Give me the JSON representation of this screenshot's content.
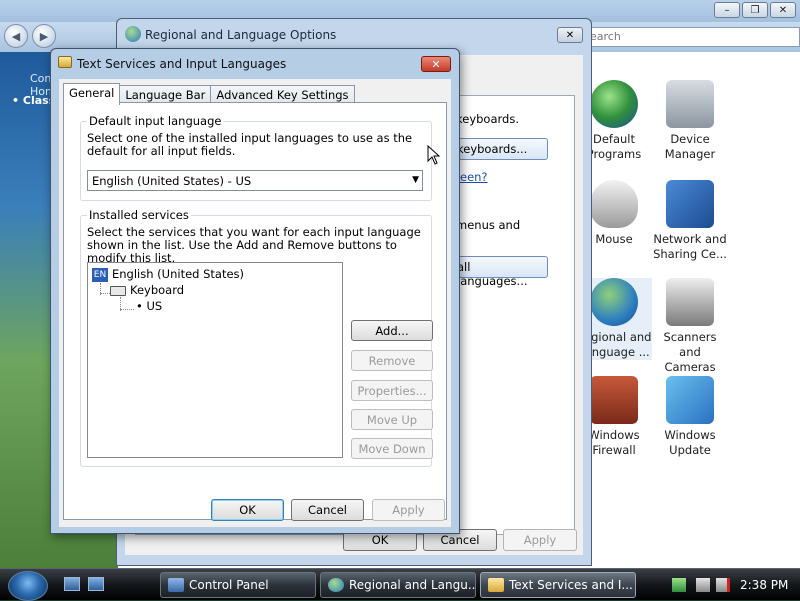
{
  "control_panel": {
    "search_placeholder": "Search",
    "sidebar": {
      "home": "Control Panel Home",
      "classic": "Classic View"
    },
    "icons": [
      {
        "label": "Default Programs"
      },
      {
        "label": "Device Manager"
      },
      {
        "label": "Mouse"
      },
      {
        "label": "Network and Sharing Ce..."
      },
      {
        "label": "Regional and Language ..."
      },
      {
        "label": "Scanners and Cameras"
      },
      {
        "label": "Windows Firewall"
      },
      {
        "label": "Windows Update"
      }
    ]
  },
  "regional_dialog": {
    "title": "Regional and Language Options",
    "text1": "keyboards.",
    "btn_keyboards": "keyboards...",
    "link": "seen?",
    "text2": "menus and",
    "btn_languages": "all languages...",
    "ok": "OK",
    "cancel": "Cancel",
    "apply": "Apply"
  },
  "text_services": {
    "title": "Text Services and Input Languages",
    "tabs": [
      "General",
      "Language Bar",
      "Advanced Key Settings"
    ],
    "default_group": {
      "label": "Default input language",
      "description": "Select one of the installed input languages to use as the default for all input fields.",
      "selected": "English (United States) - US"
    },
    "installed_group": {
      "label": "Installed services",
      "description": "Select the services that you want for each input language shown in the list. Use the Add and Remove buttons to modify this list.",
      "tree": {
        "badge": "EN",
        "language": "English (United States)",
        "keyboard": "Keyboard",
        "layout": "US"
      },
      "buttons": {
        "add": "Add...",
        "remove": "Remove",
        "properties": "Properties...",
        "move_up": "Move Up",
        "move_down": "Move Down"
      }
    },
    "footer": {
      "ok": "OK",
      "cancel": "Cancel",
      "apply": "Apply"
    }
  },
  "taskbar": {
    "tasks": [
      {
        "label": "Control Panel"
      },
      {
        "label": "Regional and Langu..."
      },
      {
        "label": "Text Services and I..."
      }
    ],
    "clock": "2:38 PM"
  }
}
